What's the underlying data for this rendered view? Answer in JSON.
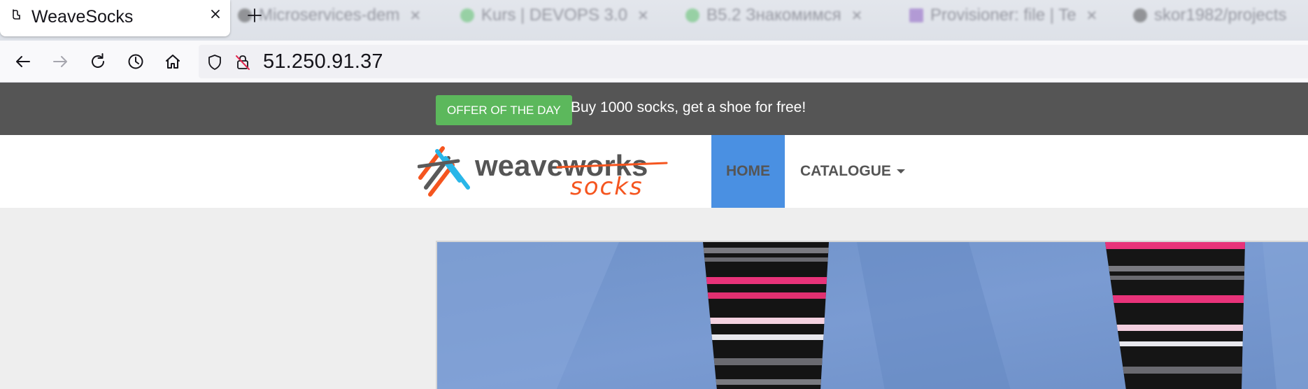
{
  "browser": {
    "active_tab": {
      "title": "WeaveSocks",
      "favicon": "page-icon"
    },
    "background_tabs": [
      {
        "title": "Microservices-dem",
        "icon": "github-icon"
      },
      {
        "title": "Kurs | DEVOPS 3.0",
        "icon": "green-dot-icon"
      },
      {
        "title": "B5.2 Знакомимся",
        "icon": "green-dot-icon"
      },
      {
        "title": "Provisioner: file | Te",
        "icon": "terraform-icon"
      },
      {
        "title": "skor1982/projects",
        "icon": "github-icon"
      }
    ],
    "url": "51.250.91.37"
  },
  "offer": {
    "badge": "OFFER OF THE DAY",
    "text": "Buy 1000 socks, get a shoe for free!"
  },
  "logo": {
    "word1": "weave",
    "word2": "works",
    "word3": "socks"
  },
  "nav": {
    "home": "HOME",
    "catalogue": "CATALOGUE"
  },
  "colors": {
    "offer_bar": "#555555",
    "offer_badge": "#5cb85c",
    "nav_active": "#4a90e2",
    "page_bg": "#eeeeee",
    "logo_orange": "#f5551f",
    "logo_blue": "#29b6e8"
  }
}
